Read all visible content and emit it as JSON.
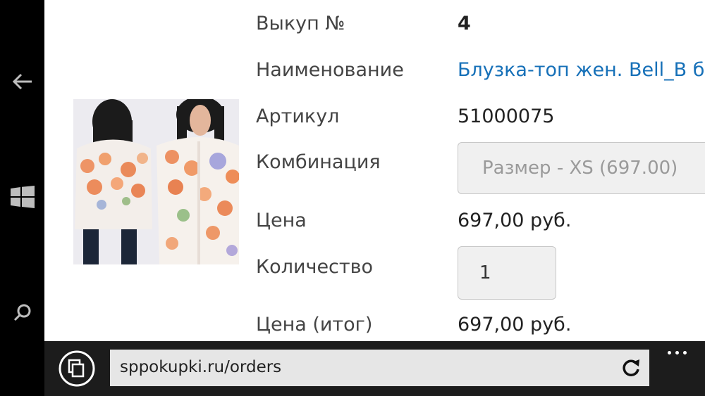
{
  "navbar": {
    "back_icon": "back-arrow-icon",
    "start_icon": "windows-logo-icon",
    "search_icon": "search-icon"
  },
  "order": {
    "rows": [
      {
        "label": "Выкуп №",
        "value": "4"
      },
      {
        "label": "Наименование",
        "value": "Блузка-топ жен. Bell_B бе"
      },
      {
        "label": "Артикул",
        "value": "51000075"
      },
      {
        "label": "Комбинация",
        "value": "Размер - XS (697.00)"
      },
      {
        "label": "Цена",
        "value": "697,00 руб."
      },
      {
        "label": "Количество",
        "value": "1"
      },
      {
        "label": "Цена (итог)",
        "value": "697,00 руб."
      }
    ]
  },
  "browser": {
    "url": "sppokupki.ru/orders",
    "tabs_icon": "tabs-icon",
    "refresh_icon": "refresh-icon",
    "more_icon": "more-ellipsis-icon"
  },
  "colors": {
    "link": "#1670b8",
    "chrome": "#1c1c1c",
    "address_bg": "#e6e6e6"
  }
}
